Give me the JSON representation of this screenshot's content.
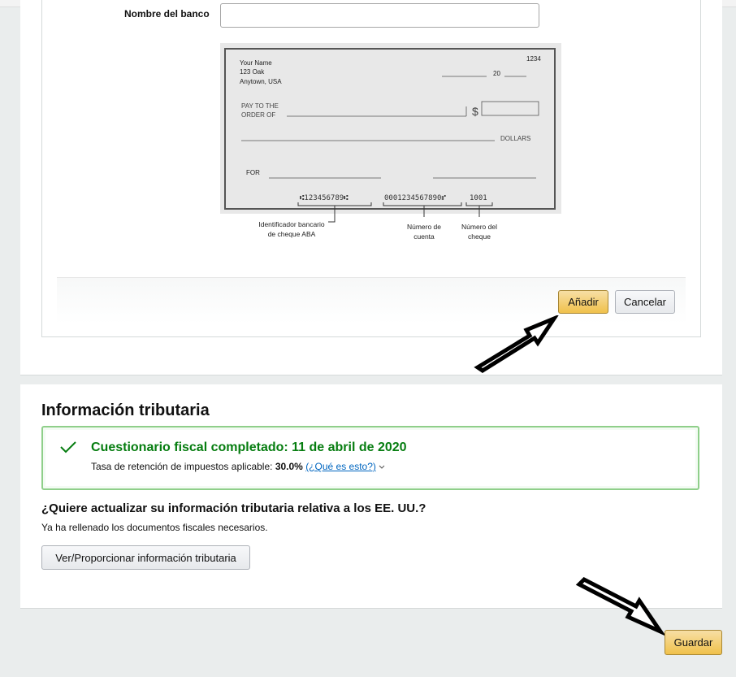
{
  "bank_form": {
    "bank_name_label": "Nombre del banco",
    "bank_name_value": ""
  },
  "check_image": {
    "name": "Your Name",
    "address_1": "123 Oak",
    "address_2": "Anytown, USA",
    "check_no": "1234",
    "year_prefix": "20",
    "pay_to_line_1": "PAY TO THE",
    "pay_to_line_2": "ORDER OF",
    "dollar_sign": "$",
    "dollars": "DOLLARS",
    "for": "FOR",
    "micr_routing": "⑆123456789⑆",
    "micr_account": "0001234567890⑈",
    "micr_check": "1001",
    "routing_label_1": "Identificador bancario",
    "routing_label_2": "de cheque ABA",
    "account_label_1": "Número de",
    "account_label_2": "cuenta",
    "checknum_label_1": "Número del",
    "checknum_label_2": "cheque"
  },
  "actions": {
    "add_label": "Añadir",
    "cancel_label": "Cancelar"
  },
  "tax": {
    "title": "Información tributaria",
    "status_title": "Cuestionario fiscal completado: 11 de abril de 2020",
    "withholding_label": "Tasa de retención de impuestos aplicable: ",
    "withholding_value": "30.0%",
    "what_is_this": "(¿Qué es esto?)",
    "update_question": "¿Quiere actualizar su información tributaria relativa a los EE. UU.?",
    "update_sub": "Ya ha rellenado los documentos fiscales necesarios.",
    "view_button": "Ver/Proporcionar información tributaria"
  },
  "footer": {
    "save_label": "Guardar"
  },
  "colors": {
    "primary_button": "#f0c14b",
    "success_green": "#067d10",
    "success_border": "#8fcf8a",
    "link_blue": "#0066c0"
  }
}
